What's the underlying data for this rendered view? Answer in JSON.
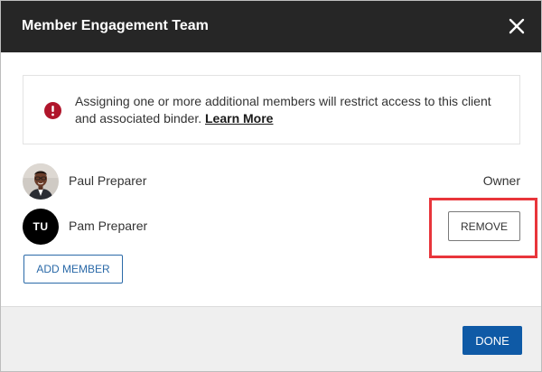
{
  "dialog": {
    "title": "Member Engagement Team",
    "close_icon": "close-icon"
  },
  "alert": {
    "icon": "exclamation-circle-icon",
    "icon_color": "#b0152b",
    "message": "Assigning one or more additional members will restrict access to this client and associated binder.",
    "link_label": "Learn More"
  },
  "members": [
    {
      "name": "Paul Preparer",
      "role": "Owner",
      "avatar": "profile-photo"
    },
    {
      "name": "Pam Preparer",
      "initials": "TU",
      "action_label": "REMOVE",
      "highlight_color": "#e8353b"
    }
  ],
  "actions": {
    "add_member_label": "ADD MEMBER",
    "done_label": "DONE"
  },
  "colors": {
    "header_bg": "#262626",
    "primary": "#0f5aa6",
    "link": "#2b6aa8",
    "footer_bg": "#efefef"
  }
}
